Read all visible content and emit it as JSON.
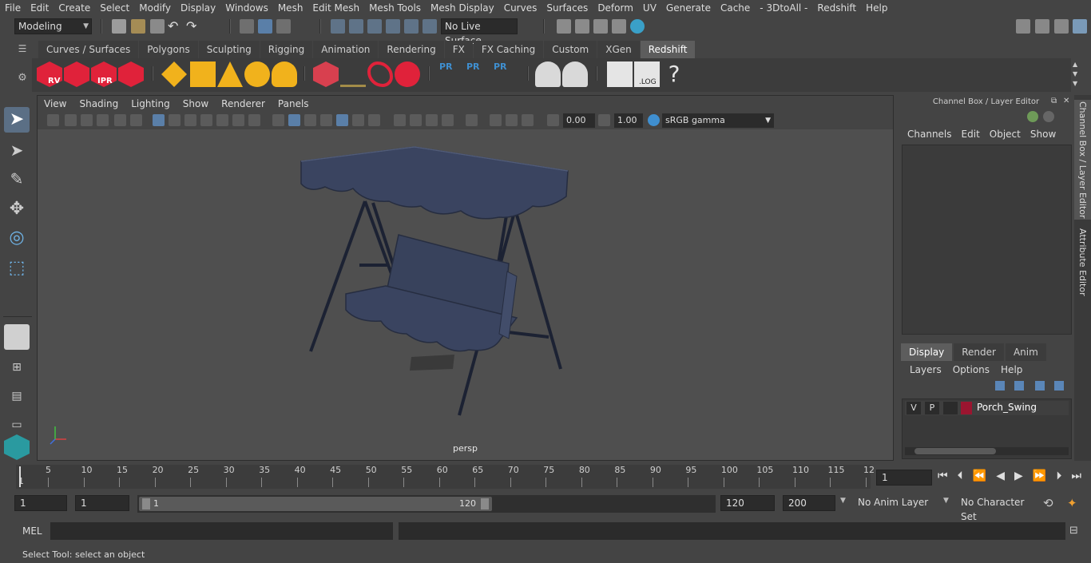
{
  "menubar": {
    "items": [
      "File",
      "Edit",
      "Create",
      "Select",
      "Modify",
      "Display",
      "Windows",
      "Mesh",
      "Edit Mesh",
      "Mesh Tools",
      "Mesh Display",
      "Curves",
      "Surfaces",
      "Deform",
      "UV",
      "Generate",
      "Cache",
      "- 3DtoAll -",
      "Redshift",
      "Help"
    ]
  },
  "statusline": {
    "mode": "Modeling",
    "live_surface": "No Live Surface"
  },
  "shelf": {
    "tabs": [
      "Curves / Surfaces",
      "Polygons",
      "Sculpting",
      "Rigging",
      "Animation",
      "Rendering",
      "FX",
      "FX Caching",
      "Custom",
      "XGen",
      "Redshift"
    ],
    "active_tab": "Redshift",
    "icon_labels": [
      "RV",
      "IPR",
      "PR",
      "PR",
      "PR",
      ".LOG",
      "?"
    ]
  },
  "viewport": {
    "menu": [
      "View",
      "Shading",
      "Lighting",
      "Show",
      "Renderer",
      "Panels"
    ],
    "exposure": "0.00",
    "gamma": "1.00",
    "color_space": "sRGB gamma",
    "camera": "persp"
  },
  "channel_box": {
    "title": "Channel Box / Layer Editor",
    "menu": [
      "Channels",
      "Edit",
      "Object",
      "Show"
    ]
  },
  "layer_editor": {
    "tabs": [
      "Display",
      "Render",
      "Anim"
    ],
    "active_tab": "Display",
    "menu": [
      "Layers",
      "Options",
      "Help"
    ],
    "layers": [
      {
        "v": "V",
        "p": "P",
        "name": "Porch_Swing",
        "color": "#9b1530"
      }
    ]
  },
  "side_tabs": [
    "Channel Box / Layer Editor",
    "Attribute Editor"
  ],
  "timeline": {
    "ticks": [
      "5",
      "10",
      "15",
      "20",
      "25",
      "30",
      "35",
      "40",
      "45",
      "50",
      "55",
      "60",
      "65",
      "70",
      "75",
      "80",
      "85",
      "90",
      "95",
      "100",
      "105",
      "110",
      "115",
      "12"
    ],
    "current_frame_marker": "1",
    "current_frame": "1"
  },
  "range": {
    "start": "1",
    "playback_start": "1",
    "slider_start": "1",
    "slider_end": "120",
    "playback_end": "120",
    "end": "200",
    "anim_layer": "No Anim Layer",
    "character_set": "No Character Set"
  },
  "cmdline": {
    "label": "MEL"
  },
  "helpline": {
    "text": "Select Tool: select an object"
  },
  "colors": {
    "background": "#444444",
    "viewport": "#4f4f4f",
    "redshift_red": "#e0223a",
    "accent_blue": "#3f8fd0",
    "swing": "#3a4460"
  }
}
